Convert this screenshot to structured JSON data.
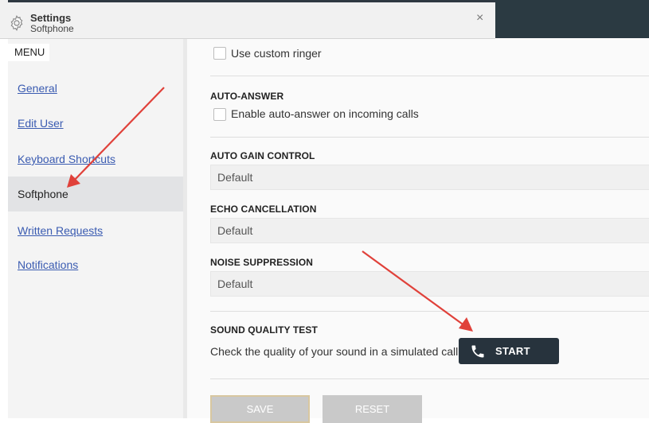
{
  "window": {
    "title": "Settings",
    "subtitle": "Softphone",
    "close_glyph": "×"
  },
  "sidebar": {
    "menu_label": "MENU",
    "items": [
      {
        "label": "General",
        "active": false
      },
      {
        "label": "Edit User",
        "active": false
      },
      {
        "label": "Keyboard Shortcuts",
        "active": false
      },
      {
        "label": "Softphone",
        "active": true
      },
      {
        "label": "Written Requests",
        "active": false
      },
      {
        "label": "Notifications",
        "active": false
      }
    ]
  },
  "main": {
    "custom_ringer": {
      "label": "Use custom ringer",
      "checked": false
    },
    "auto_answer": {
      "title": "AUTO-ANSWER",
      "checkbox_label": "Enable auto-answer on incoming calls",
      "checked": false
    },
    "auto_gain_control": {
      "title": "AUTO GAIN CONTROL",
      "value": "Default"
    },
    "echo_cancellation": {
      "title": "ECHO CANCELLATION",
      "value": "Default"
    },
    "noise_suppression": {
      "title": "NOISE SUPPRESSION",
      "value": "Default"
    },
    "sound_quality_test": {
      "title": "SOUND QUALITY TEST",
      "description": "Check the quality of your sound in a simulated call",
      "start_label": "START"
    },
    "save_label": "SAVE",
    "reset_label": "RESET"
  },
  "colors": {
    "annotation_arrow": "#e0413a",
    "start_button": "#27333d",
    "link": "#3a5bb1"
  },
  "icons": [
    "gear-icon",
    "close-icon",
    "phone-icon"
  ]
}
